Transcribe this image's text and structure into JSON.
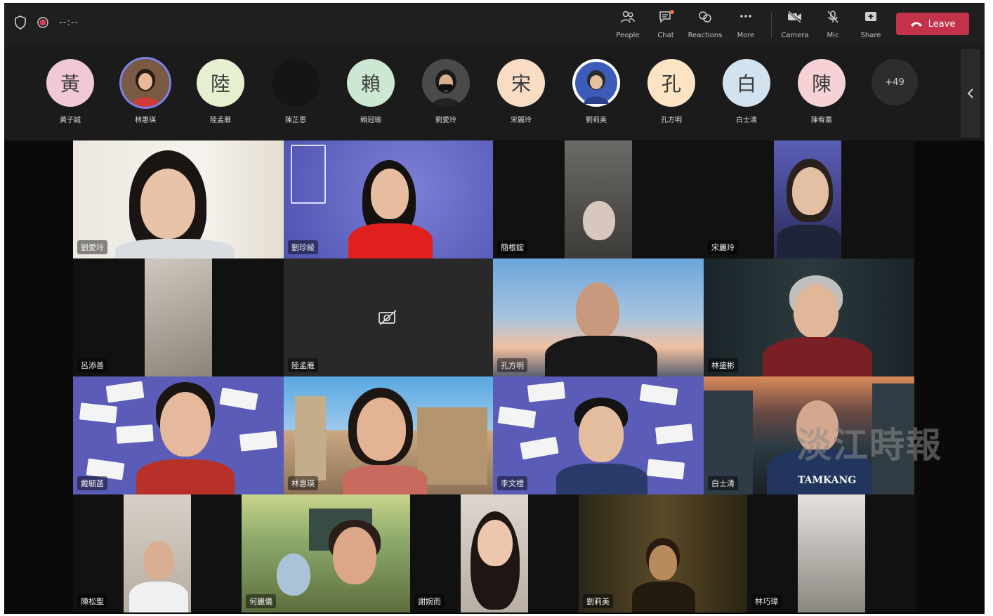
{
  "topbar": {
    "timer": "--:--",
    "buttons": {
      "people": "People",
      "chat": "Chat",
      "reactions": "Reactions",
      "more": "More",
      "camera": "Camera",
      "mic": "Mic",
      "share": "Share"
    },
    "leave": "Leave",
    "leave_color": "#c4314b"
  },
  "strip": {
    "participants": [
      {
        "initial": "黃",
        "name": "黃子誠",
        "color": "#f0c8d6"
      },
      {
        "initial": "",
        "name": "林惠瑛",
        "color": "#6a4a3a"
      },
      {
        "initial": "陸",
        "name": "陸孟雁",
        "color": "#e6f0d0"
      },
      {
        "initial": "",
        "name": "陳芷恩",
        "color": "#151515"
      },
      {
        "initial": "賴",
        "name": "賴冠瑜",
        "color": "#cde8d2"
      },
      {
        "initial": "",
        "name": "劉愛玲",
        "color": "#3a3a3a"
      },
      {
        "initial": "宋",
        "name": "宋麗玲",
        "color": "#f8dcc4"
      },
      {
        "initial": "",
        "name": "劉莉美",
        "color": "#5b77c8"
      },
      {
        "initial": "孔",
        "name": "孔方明",
        "color": "#fbe3c4"
      },
      {
        "initial": "白",
        "name": "白士清",
        "color": "#d2e3ef"
      },
      {
        "initial": "陳",
        "name": "陳宥蓁",
        "color": "#f6d2d6"
      }
    ],
    "overflow": "+49"
  },
  "tiles": {
    "t1": "劉愛玲",
    "t2": "劉珍綾",
    "t3": "簡根鋐",
    "t4": "宋麗玲",
    "t5": "呂添善",
    "t6": "陸孟雁",
    "t7": "孔方明",
    "t8": "林盛彬",
    "t9": "戴毓菡",
    "t10": "林惠瑛",
    "t11": "李文禮",
    "t12": "白士清",
    "t13": "陳松聖",
    "t14": "何麗儀",
    "t15": "謝婉而",
    "t16": "劉莉美",
    "t17": "林巧璋"
  },
  "shirt_text": "TAMKANG",
  "watermark": "淡江時報"
}
